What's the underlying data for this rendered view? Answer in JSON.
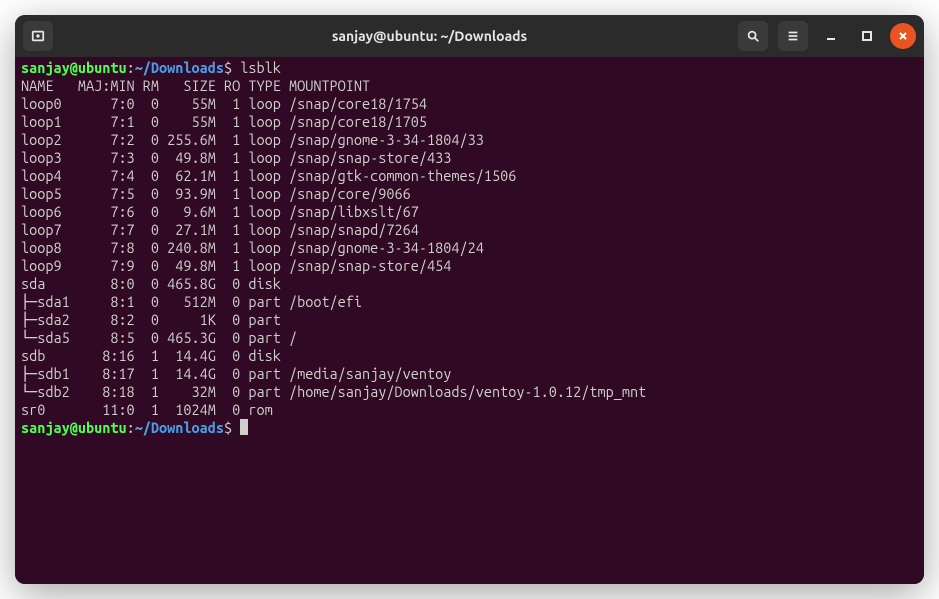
{
  "window": {
    "title": "sanjay@ubuntu: ~/Downloads"
  },
  "prompt": {
    "userhost": "sanjay@ubuntu",
    "path": "~/Downloads",
    "dollar": "$"
  },
  "command": "lsblk",
  "header": {
    "name": "NAME",
    "majmin": "MAJ:MIN",
    "rm": "RM",
    "size": "SIZE",
    "ro": "RO",
    "type": "TYPE",
    "mountpoint": "MOUNTPOINT"
  },
  "rows": [
    {
      "tree": "",
      "name": "loop0",
      "majmin": "7:0",
      "rm": "0",
      "size": "55M",
      "ro": "1",
      "type": "loop",
      "mount": "/snap/core18/1754"
    },
    {
      "tree": "",
      "name": "loop1",
      "majmin": "7:1",
      "rm": "0",
      "size": "55M",
      "ro": "1",
      "type": "loop",
      "mount": "/snap/core18/1705"
    },
    {
      "tree": "",
      "name": "loop2",
      "majmin": "7:2",
      "rm": "0",
      "size": "255.6M",
      "ro": "1",
      "type": "loop",
      "mount": "/snap/gnome-3-34-1804/33"
    },
    {
      "tree": "",
      "name": "loop3",
      "majmin": "7:3",
      "rm": "0",
      "size": "49.8M",
      "ro": "1",
      "type": "loop",
      "mount": "/snap/snap-store/433"
    },
    {
      "tree": "",
      "name": "loop4",
      "majmin": "7:4",
      "rm": "0",
      "size": "62.1M",
      "ro": "1",
      "type": "loop",
      "mount": "/snap/gtk-common-themes/1506"
    },
    {
      "tree": "",
      "name": "loop5",
      "majmin": "7:5",
      "rm": "0",
      "size": "93.9M",
      "ro": "1",
      "type": "loop",
      "mount": "/snap/core/9066"
    },
    {
      "tree": "",
      "name": "loop6",
      "majmin": "7:6",
      "rm": "0",
      "size": "9.6M",
      "ro": "1",
      "type": "loop",
      "mount": "/snap/libxslt/67"
    },
    {
      "tree": "",
      "name": "loop7",
      "majmin": "7:7",
      "rm": "0",
      "size": "27.1M",
      "ro": "1",
      "type": "loop",
      "mount": "/snap/snapd/7264"
    },
    {
      "tree": "",
      "name": "loop8",
      "majmin": "7:8",
      "rm": "0",
      "size": "240.8M",
      "ro": "1",
      "type": "loop",
      "mount": "/snap/gnome-3-34-1804/24"
    },
    {
      "tree": "",
      "name": "loop9",
      "majmin": "7:9",
      "rm": "0",
      "size": "49.8M",
      "ro": "1",
      "type": "loop",
      "mount": "/snap/snap-store/454"
    },
    {
      "tree": "",
      "name": "sda",
      "majmin": "8:0",
      "rm": "0",
      "size": "465.8G",
      "ro": "0",
      "type": "disk",
      "mount": ""
    },
    {
      "tree": "├─",
      "name": "sda1",
      "majmin": "8:1",
      "rm": "0",
      "size": "512M",
      "ro": "0",
      "type": "part",
      "mount": "/boot/efi"
    },
    {
      "tree": "├─",
      "name": "sda2",
      "majmin": "8:2",
      "rm": "0",
      "size": "1K",
      "ro": "0",
      "type": "part",
      "mount": ""
    },
    {
      "tree": "└─",
      "name": "sda5",
      "majmin": "8:5",
      "rm": "0",
      "size": "465.3G",
      "ro": "0",
      "type": "part",
      "mount": "/"
    },
    {
      "tree": "",
      "name": "sdb",
      "majmin": "8:16",
      "rm": "1",
      "size": "14.4G",
      "ro": "0",
      "type": "disk",
      "mount": ""
    },
    {
      "tree": "├─",
      "name": "sdb1",
      "majmin": "8:17",
      "rm": "1",
      "size": "14.4G",
      "ro": "0",
      "type": "part",
      "mount": "/media/sanjay/ventoy"
    },
    {
      "tree": "└─",
      "name": "sdb2",
      "majmin": "8:18",
      "rm": "1",
      "size": "32M",
      "ro": "0",
      "type": "part",
      "mount": "/home/sanjay/Downloads/ventoy-1.0.12/tmp_mnt"
    },
    {
      "tree": "",
      "name": "sr0",
      "majmin": "11:0",
      "rm": "1",
      "size": "1024M",
      "ro": "0",
      "type": "rom",
      "mount": ""
    }
  ]
}
